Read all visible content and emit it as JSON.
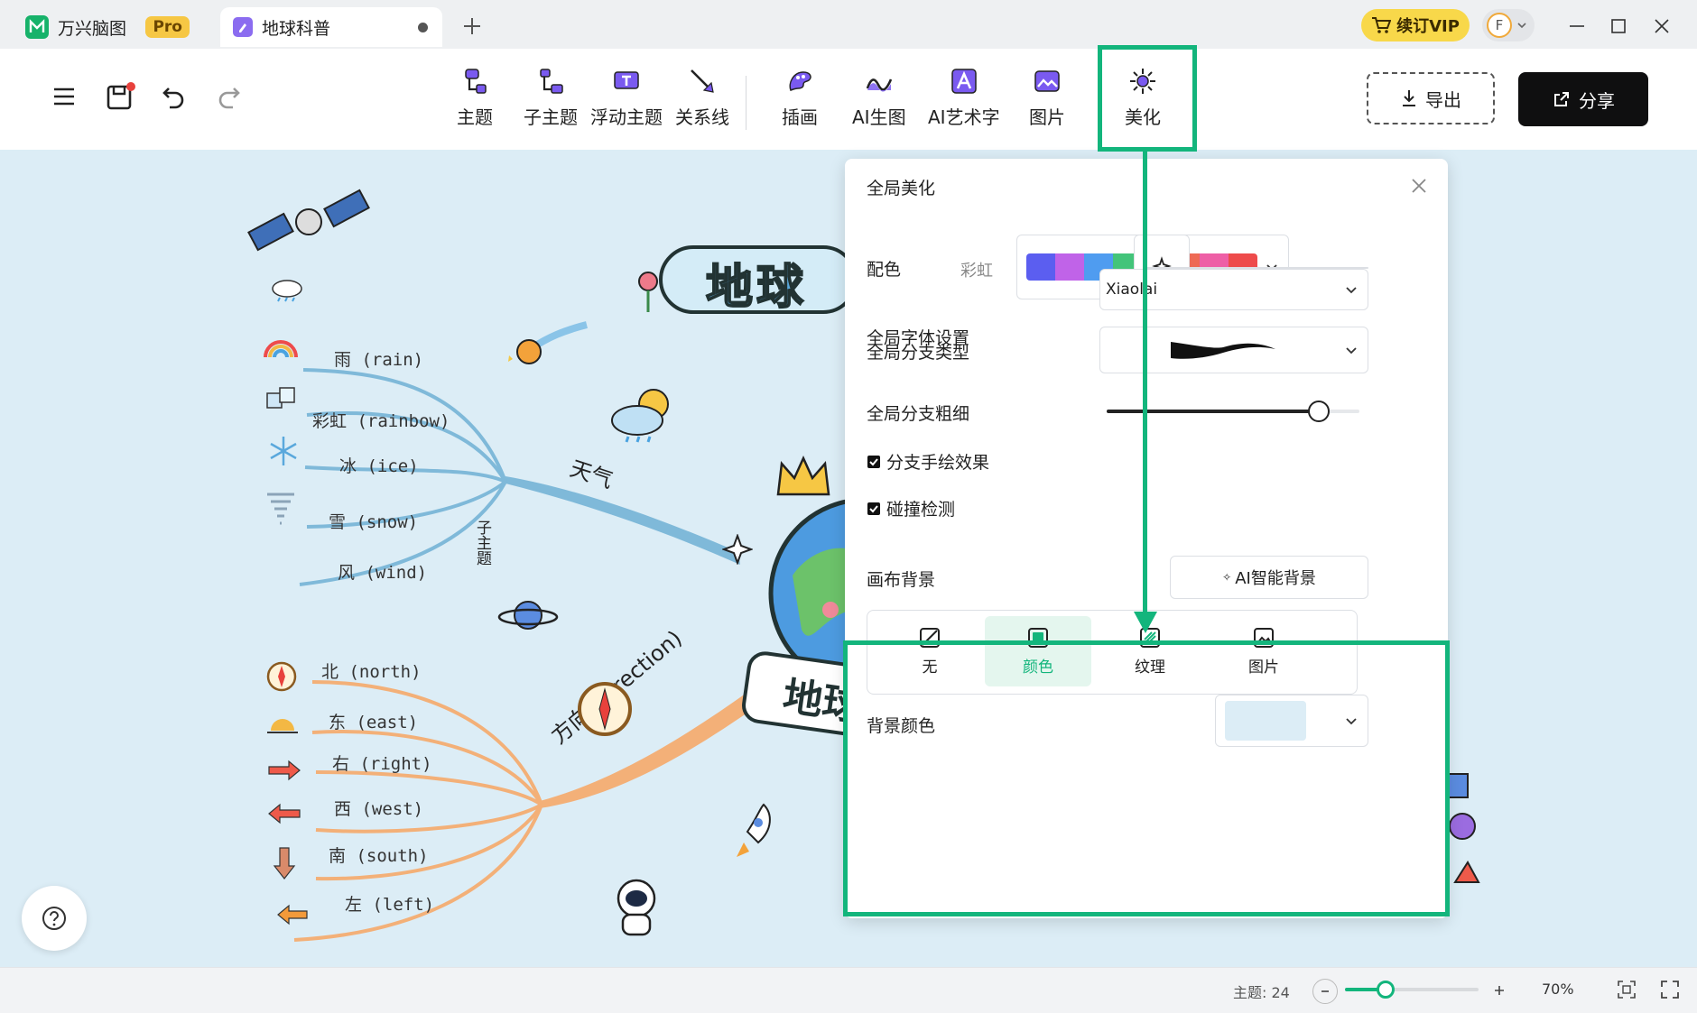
{
  "tabs": {
    "app_name": "万兴脑图",
    "app_badge": "Pro",
    "doc_name": "地球科普"
  },
  "titlebar": {
    "vip_label": "续订VIP",
    "avatar_letter": "F"
  },
  "toolbar": {
    "items": [
      {
        "label": "主题",
        "icon": "topic-icon"
      },
      {
        "label": "子主题",
        "icon": "subtopic-icon"
      },
      {
        "label": "浮动主题",
        "icon": "floating-topic-icon"
      },
      {
        "label": "关系线",
        "icon": "relation-line-icon"
      },
      {
        "label": "插画",
        "icon": "illustration-icon"
      },
      {
        "label": "AI生图",
        "icon": "ai-image-icon"
      },
      {
        "label": "AI艺术字",
        "icon": "ai-art-text-icon"
      },
      {
        "label": "图片",
        "icon": "image-icon"
      },
      {
        "label": "美化",
        "icon": "beautify-icon"
      }
    ],
    "export_label": "导出",
    "share_label": "分享"
  },
  "mindmap": {
    "central": "地球",
    "central_banner": "地球",
    "weather_branch": "天气",
    "subtopic_label": "子主题",
    "weather_leaves": [
      "雨 (rain)",
      "彩虹 (rainbow)",
      "冰 (ice)",
      "雪 (snow)",
      "风 (wind)"
    ],
    "direction_branch": "方向 (direction)",
    "direction_leaves": [
      "北 (north)",
      "东 (east)",
      "右 (right)",
      "西 (west)",
      "南 (south)",
      "左 (left)"
    ]
  },
  "panel": {
    "title": "全局美化",
    "color_label": "配色",
    "color_scheme_name": "彩虹",
    "palette": [
      "#5b5ef0",
      "#c063e8",
      "#4f9cf0",
      "#43c47a",
      "#f39a1f",
      "#ee6a55",
      "#ee5fa6",
      "#ee4b4b"
    ],
    "font_label": "全局字体设置",
    "font_value": "Xiaolai",
    "branch_type_label": "全局分支类型",
    "branch_width_label": "全局分支粗细",
    "branch_width_value": 0.87,
    "hand_drawn_label": "分支手绘效果",
    "collision_label": "碰撞检测",
    "canvas_bg_label": "画布背景",
    "ai_bg_button": "AI智能背景",
    "bg_options": [
      "无",
      "颜色",
      "纹理",
      "图片"
    ],
    "bg_selected": "颜色",
    "bg_color_label": "背景颜色",
    "bg_color_value": "#dcedf6"
  },
  "statusbar": {
    "topic_count": "主题: 24",
    "zoom": "70%",
    "zoom_value": 0.27
  },
  "colors": {
    "accent_green": "#13b57c",
    "weather_branch": "#7fb9d9",
    "direction_branch": "#f3b078"
  }
}
